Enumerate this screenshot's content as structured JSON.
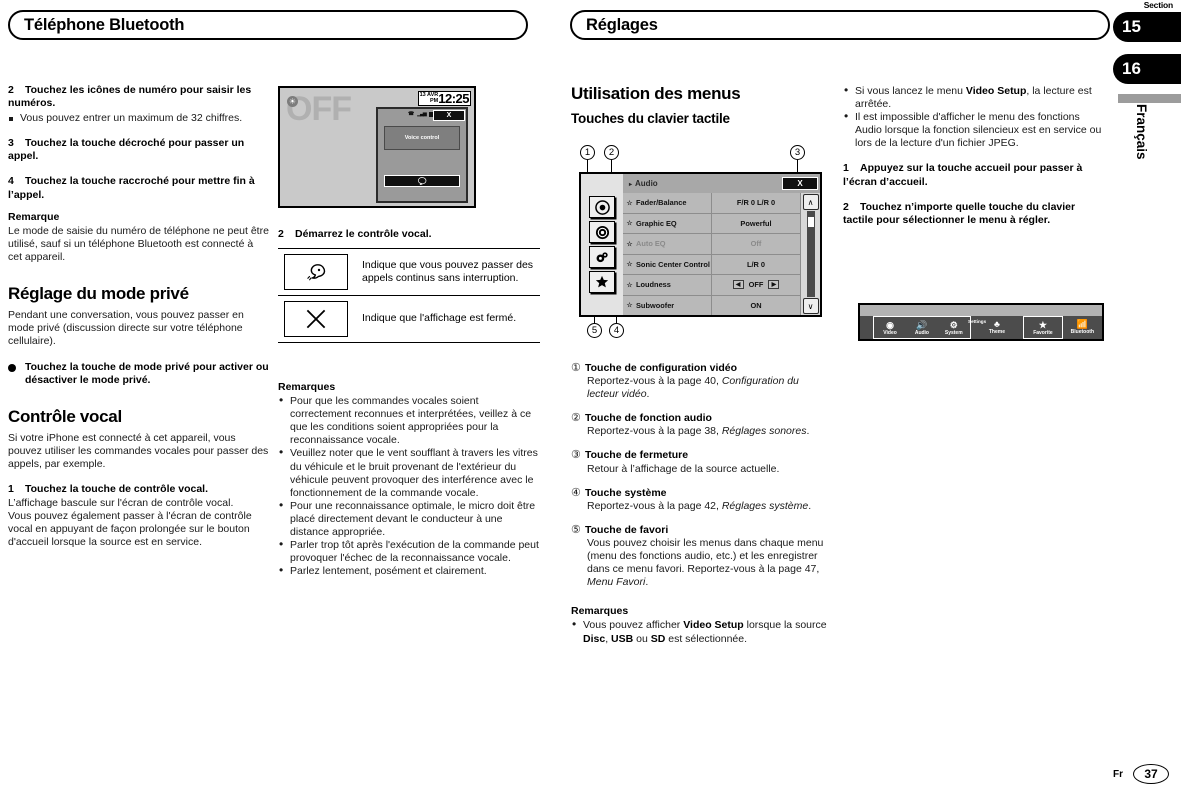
{
  "runheads": {
    "left": "Téléphone Bluetooth",
    "right": "Réglages"
  },
  "section_marker": {
    "label": "Section",
    "tab_a": "15",
    "tab_b": "16",
    "language_vertical": "Français"
  },
  "footer": {
    "lang_code": "Fr",
    "page_number": "37"
  },
  "col1": {
    "step2": {
      "num": "2",
      "text": "Touchez les icônes de numéro pour saisir les numéros."
    },
    "step2_note": "Vous pouvez entrer un maximum de 32 chiffres.",
    "step3": {
      "num": "3",
      "text": "Touchez la touche décroché pour passer un appel."
    },
    "step4": {
      "num": "4",
      "text": "Touchez la touche raccroché pour mettre fin à l’appel."
    },
    "remark_title": "Remarque",
    "remark_text": "Le mode de saisie du numéro de téléphone ne peut être utilisé, sauf si un téléphone Bluetooth est connecté à cet appareil.",
    "h1_private": "Réglage du mode privé",
    "private_text": "Pendant une conversation, vous pouvez passer en mode privé (discussion directe sur votre téléphone cellulaire).",
    "private_bullet": "Touchez la touche de mode privé pour activer ou désactiver le mode privé.",
    "h1_voice": "Contrôle vocal",
    "voice_text": "Si votre iPhone est connecté à cet appareil, vous pouvez utiliser les commandes vocales pour passer des appels, par exemple.",
    "step1": {
      "num": "1",
      "text": "Touchez la touche de contrôle vocal."
    },
    "step1_body_a": "L’affichage bascule sur l'écran de contrôle vocal.",
    "step1_body_b": "Vous pouvez également passer à l'écran de contrôle vocal en appuyant de façon prolongée sur le bouton d'accueil lorsque la source est en service."
  },
  "voice_screen": {
    "off_text": "OFF",
    "source_icon": "source-icon",
    "clock_date": "13 AVR",
    "clock_ampm": "PM",
    "clock_time": "12:25",
    "status_signal": "signal-bars-icon",
    "status_battery": "battery-icon",
    "close_label": "X",
    "panel_label": "Voice control",
    "mic_icon": "voice-talk-icon"
  },
  "col2": {
    "step2": {
      "num": "2",
      "text": "Démarrez le contrôle vocal."
    },
    "icon_table": [
      {
        "icon": "voice-talk-icon",
        "desc": "Indique que vous pouvez passer des appels continus sans interruption."
      },
      {
        "icon": "close-x-icon",
        "desc": "Indique que l'affichage est fermé."
      }
    ],
    "remarks_title": "Remarques",
    "remarks": [
      "Pour que les commandes vocales soient correctement reconnues et interprétées, veillez à ce que les conditions soient appropriées pour la reconnaissance vocale.",
      "Veuillez noter que le vent soufflant à travers les vitres du véhicule et le bruit provenant de l'extérieur du véhicule peuvent provoquer des interférence avec le fonctionnement de la commande vocale.",
      "Pour une reconnaissance optimale, le micro doit être placé directement devant le conducteur à une distance appropriée.",
      "Parler trop tôt après l'exécution de la commande peut provoquer l'échec de la reconnaissance vocale.",
      "Parlez lentement, posément et clairement."
    ]
  },
  "col3": {
    "h1": "Utilisation des menus",
    "h2": "Touches du clavier tactile",
    "items": [
      {
        "marker": "①",
        "title": "Touche de configuration vidéo",
        "body_pre": "Reportez-vous à la page 40, ",
        "body_em": "Configuration du lecteur vidéo",
        "body_post": "."
      },
      {
        "marker": "②",
        "title": "Touche de fonction audio",
        "body_pre": "Reportez-vous à la page 38, ",
        "body_em": "Réglages sonores",
        "body_post": "."
      },
      {
        "marker": "③",
        "title": "Touche de fermeture",
        "body_pre": "Retour à l’affichage de la source actuelle.",
        "body_em": "",
        "body_post": ""
      },
      {
        "marker": "④",
        "title": "Touche système",
        "body_pre": "Reportez-vous à la page 42, ",
        "body_em": "Réglages système",
        "body_post": "."
      },
      {
        "marker": "⑤",
        "title": "Touche de favori",
        "body_pre": "Vous pouvez choisir les menus dans chaque menu (menu des fonctions audio, etc.) et les enregistrer dans ce menu favori. Reportez-vous à la page 47, ",
        "body_em": "Menu Favori",
        "body_post": "."
      }
    ],
    "remarks_title": "Remarques",
    "remark_parts": {
      "a": "Vous pouvez afficher ",
      "b": "Video Setup",
      "c": " lorsque la source ",
      "d": "Disc",
      "e": ", ",
      "f": "USB",
      "g": " ou ",
      "h": "SD",
      "i": " est sélectionnée."
    }
  },
  "menu_screen": {
    "callouts": [
      "1",
      "2",
      "3",
      "4",
      "5"
    ],
    "title": "Audio",
    "close_label": "X",
    "sidebar_icons": [
      "video-setup-icon",
      "audio-function-icon",
      "system-icon",
      "favorite-star-icon"
    ],
    "scroll_up": "scroll-up-icon",
    "scroll_down": "scroll-down-icon",
    "rows": [
      {
        "label": "Fader/Balance",
        "value": "F/R 0  L/R 0",
        "dim": false,
        "stepper": false
      },
      {
        "label": "Graphic EQ",
        "value": "Powerful",
        "dim": false,
        "stepper": false
      },
      {
        "label": "Auto EQ",
        "value": "Off",
        "dim": true,
        "stepper": false
      },
      {
        "label": "Sonic Center Control",
        "value": "L/R 0",
        "dim": false,
        "stepper": false
      },
      {
        "label": "Loudness",
        "value": "OFF",
        "dim": false,
        "stepper": true
      },
      {
        "label": "Subwoofer",
        "value": "ON",
        "dim": false,
        "stepper": false
      }
    ]
  },
  "col4": {
    "remarks": [
      {
        "a": "Si vous lancez le menu ",
        "b": "Video Setup",
        "c": ", la lecture est arrêtée."
      },
      {
        "a": "Il est impossible d'afficher le menu des fonctions Audio lorsque la fonction silencieux est en service ou lors de la lecture d'un fichier JPEG.",
        "b": "",
        "c": ""
      }
    ],
    "step1": {
      "num": "1",
      "text": "Appuyez sur la touche accueil pour passer à l’écran d’accueil."
    },
    "step2": {
      "num": "2",
      "text": "Touchez n’importe quelle touche du clavier tactile pour sélectionner le menu à régler."
    }
  },
  "toolbar_screen": {
    "settings_label": "Settings",
    "buttons": [
      {
        "label": "Video",
        "icon": "video-disc-icon",
        "grouped": true
      },
      {
        "label": "Audio",
        "icon": "speaker-icon",
        "grouped": true
      },
      {
        "label": "System",
        "icon": "gear-icon",
        "grouped": true
      },
      {
        "label": "Theme",
        "icon": "theme-icon",
        "grouped": false
      },
      {
        "label": "Favorite",
        "icon": "favorite-star-icon",
        "grouped": true
      },
      {
        "label": "Bluetooth",
        "icon": "bluetooth-icon",
        "grouped": false
      }
    ]
  }
}
